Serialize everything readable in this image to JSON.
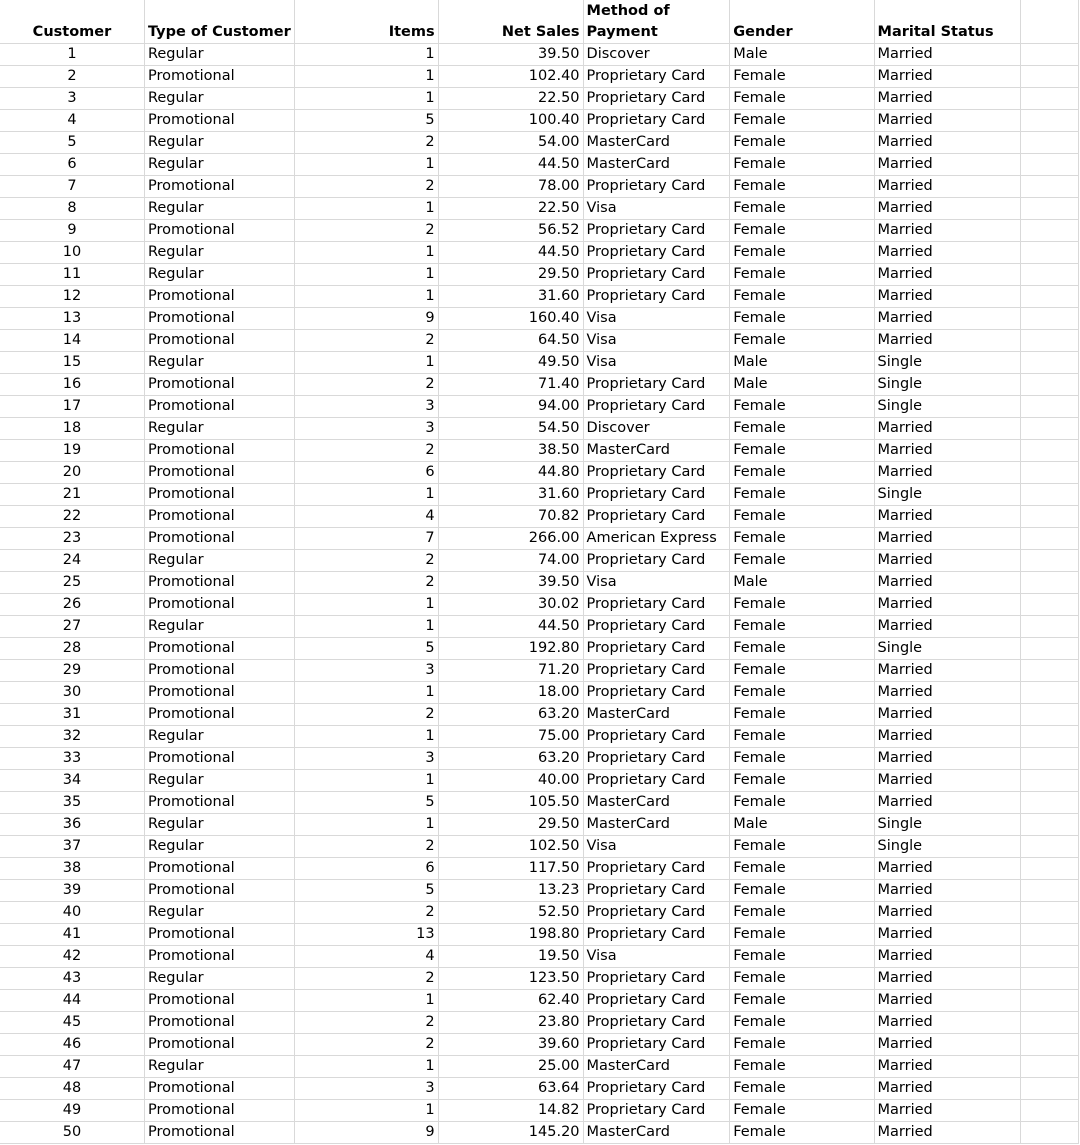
{
  "sheet": {
    "headers": {
      "customer": "Customer",
      "type": "Type of Customer",
      "items": "Items",
      "net_sales": "Net Sales",
      "payment_line1": "Method of",
      "payment_line2": "Payment",
      "gender": "Gender",
      "marital": "Marital Status"
    },
    "rows": [
      [
        "1",
        "Regular",
        "1",
        "39.50",
        "Discover",
        "Male",
        "Married"
      ],
      [
        "2",
        "Promotional",
        "1",
        "102.40",
        "Proprietary Card",
        "Female",
        "Married"
      ],
      [
        "3",
        "Regular",
        "1",
        "22.50",
        "Proprietary Card",
        "Female",
        "Married"
      ],
      [
        "4",
        "Promotional",
        "5",
        "100.40",
        "Proprietary Card",
        "Female",
        "Married"
      ],
      [
        "5",
        "Regular",
        "2",
        "54.00",
        "MasterCard",
        "Female",
        "Married"
      ],
      [
        "6",
        "Regular",
        "1",
        "44.50",
        "MasterCard",
        "Female",
        "Married"
      ],
      [
        "7",
        "Promotional",
        "2",
        "78.00",
        "Proprietary Card",
        "Female",
        "Married"
      ],
      [
        "8",
        "Regular",
        "1",
        "22.50",
        "Visa",
        "Female",
        "Married"
      ],
      [
        "9",
        "Promotional",
        "2",
        "56.52",
        "Proprietary Card",
        "Female",
        "Married"
      ],
      [
        "10",
        "Regular",
        "1",
        "44.50",
        "Proprietary Card",
        "Female",
        "Married"
      ],
      [
        "11",
        "Regular",
        "1",
        "29.50",
        "Proprietary Card",
        "Female",
        "Married"
      ],
      [
        "12",
        "Promotional",
        "1",
        "31.60",
        "Proprietary Card",
        "Female",
        "Married"
      ],
      [
        "13",
        "Promotional",
        "9",
        "160.40",
        "Visa",
        "Female",
        "Married"
      ],
      [
        "14",
        "Promotional",
        "2",
        "64.50",
        "Visa",
        "Female",
        "Married"
      ],
      [
        "15",
        "Regular",
        "1",
        "49.50",
        "Visa",
        "Male",
        "Single"
      ],
      [
        "16",
        "Promotional",
        "2",
        "71.40",
        "Proprietary Card",
        "Male",
        "Single"
      ],
      [
        "17",
        "Promotional",
        "3",
        "94.00",
        "Proprietary Card",
        "Female",
        "Single"
      ],
      [
        "18",
        "Regular",
        "3",
        "54.50",
        "Discover",
        "Female",
        "Married"
      ],
      [
        "19",
        "Promotional",
        "2",
        "38.50",
        "MasterCard",
        "Female",
        "Married"
      ],
      [
        "20",
        "Promotional",
        "6",
        "44.80",
        "Proprietary Card",
        "Female",
        "Married"
      ],
      [
        "21",
        "Promotional",
        "1",
        "31.60",
        "Proprietary Card",
        "Female",
        "Single"
      ],
      [
        "22",
        "Promotional",
        "4",
        "70.82",
        "Proprietary Card",
        "Female",
        "Married"
      ],
      [
        "23",
        "Promotional",
        "7",
        "266.00",
        "American Express",
        "Female",
        "Married"
      ],
      [
        "24",
        "Regular",
        "2",
        "74.00",
        "Proprietary Card",
        "Female",
        "Married"
      ],
      [
        "25",
        "Promotional",
        "2",
        "39.50",
        "Visa",
        "Male",
        "Married"
      ],
      [
        "26",
        "Promotional",
        "1",
        "30.02",
        "Proprietary Card",
        "Female",
        "Married"
      ],
      [
        "27",
        "Regular",
        "1",
        "44.50",
        "Proprietary Card",
        "Female",
        "Married"
      ],
      [
        "28",
        "Promotional",
        "5",
        "192.80",
        "Proprietary Card",
        "Female",
        "Single"
      ],
      [
        "29",
        "Promotional",
        "3",
        "71.20",
        "Proprietary Card",
        "Female",
        "Married"
      ],
      [
        "30",
        "Promotional",
        "1",
        "18.00",
        "Proprietary Card",
        "Female",
        "Married"
      ],
      [
        "31",
        "Promotional",
        "2",
        "63.20",
        "MasterCard",
        "Female",
        "Married"
      ],
      [
        "32",
        "Regular",
        "1",
        "75.00",
        "Proprietary Card",
        "Female",
        "Married"
      ],
      [
        "33",
        "Promotional",
        "3",
        "63.20",
        "Proprietary Card",
        "Female",
        "Married"
      ],
      [
        "34",
        "Regular",
        "1",
        "40.00",
        "Proprietary Card",
        "Female",
        "Married"
      ],
      [
        "35",
        "Promotional",
        "5",
        "105.50",
        "MasterCard",
        "Female",
        "Married"
      ],
      [
        "36",
        "Regular",
        "1",
        "29.50",
        "MasterCard",
        "Male",
        "Single"
      ],
      [
        "37",
        "Regular",
        "2",
        "102.50",
        "Visa",
        "Female",
        "Single"
      ],
      [
        "38",
        "Promotional",
        "6",
        "117.50",
        "Proprietary Card",
        "Female",
        "Married"
      ],
      [
        "39",
        "Promotional",
        "5",
        "13.23",
        "Proprietary Card",
        "Female",
        "Married"
      ],
      [
        "40",
        "Regular",
        "2",
        "52.50",
        "Proprietary Card",
        "Female",
        "Married"
      ],
      [
        "41",
        "Promotional",
        "13",
        "198.80",
        "Proprietary Card",
        "Female",
        "Married"
      ],
      [
        "42",
        "Promotional",
        "4",
        "19.50",
        "Visa",
        "Female",
        "Married"
      ],
      [
        "43",
        "Regular",
        "2",
        "123.50",
        "Proprietary Card",
        "Female",
        "Married"
      ],
      [
        "44",
        "Promotional",
        "1",
        "62.40",
        "Proprietary Card",
        "Female",
        "Married"
      ],
      [
        "45",
        "Promotional",
        "2",
        "23.80",
        "Proprietary Card",
        "Female",
        "Married"
      ],
      [
        "46",
        "Promotional",
        "2",
        "39.60",
        "Proprietary Card",
        "Female",
        "Married"
      ],
      [
        "47",
        "Regular",
        "1",
        "25.00",
        "MasterCard",
        "Female",
        "Married"
      ],
      [
        "48",
        "Promotional",
        "3",
        "63.64",
        "Proprietary Card",
        "Female",
        "Married"
      ],
      [
        "49",
        "Promotional",
        "1",
        "14.82",
        "Proprietary Card",
        "Female",
        "Married"
      ],
      [
        "50",
        "Promotional",
        "9",
        "145.20",
        "MasterCard",
        "Female",
        "Married"
      ]
    ]
  }
}
